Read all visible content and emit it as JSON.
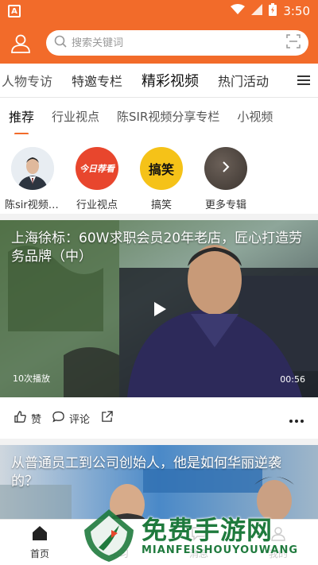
{
  "status_bar": {
    "time": "3:50",
    "app_badge": "A"
  },
  "search": {
    "placeholder": "搜索关键词"
  },
  "main_tabs": [
    {
      "label": "人物专访"
    },
    {
      "label": "特邀专栏"
    },
    {
      "label": "精彩视频"
    },
    {
      "label": "热门活动"
    }
  ],
  "sub_tabs": [
    {
      "label": "推荐"
    },
    {
      "label": "行业视点"
    },
    {
      "label": "陈SIR视频分享专栏"
    },
    {
      "label": "小视频"
    }
  ],
  "albums": [
    {
      "label": "陈sir视频分享专栏"
    },
    {
      "label": "行业视点",
      "thumb_text": "今日荐看"
    },
    {
      "label": "搞笑",
      "thumb_text": "搞笑"
    },
    {
      "label": "更多专辑"
    }
  ],
  "videos": [
    {
      "title": "上海徐标：60W求职会员20年老店，匠心打造劳务品牌（中）",
      "play_count": "10次播放",
      "duration": "00:56",
      "like_label": "赞",
      "comment_label": "评论"
    },
    {
      "title": "从普通员工到公司创始人，他是如何华丽逆袭的？"
    }
  ],
  "bottom_nav": [
    {
      "label": "首页"
    },
    {
      "label": "学习"
    },
    {
      "label": "消息"
    },
    {
      "label": "我的"
    }
  ],
  "watermark": {
    "cn": "免费手游网",
    "en": "MIANFEISHOUYOUWANG"
  },
  "colors": {
    "accent": "#f26b2a",
    "watermark": "#1f7a3d"
  }
}
